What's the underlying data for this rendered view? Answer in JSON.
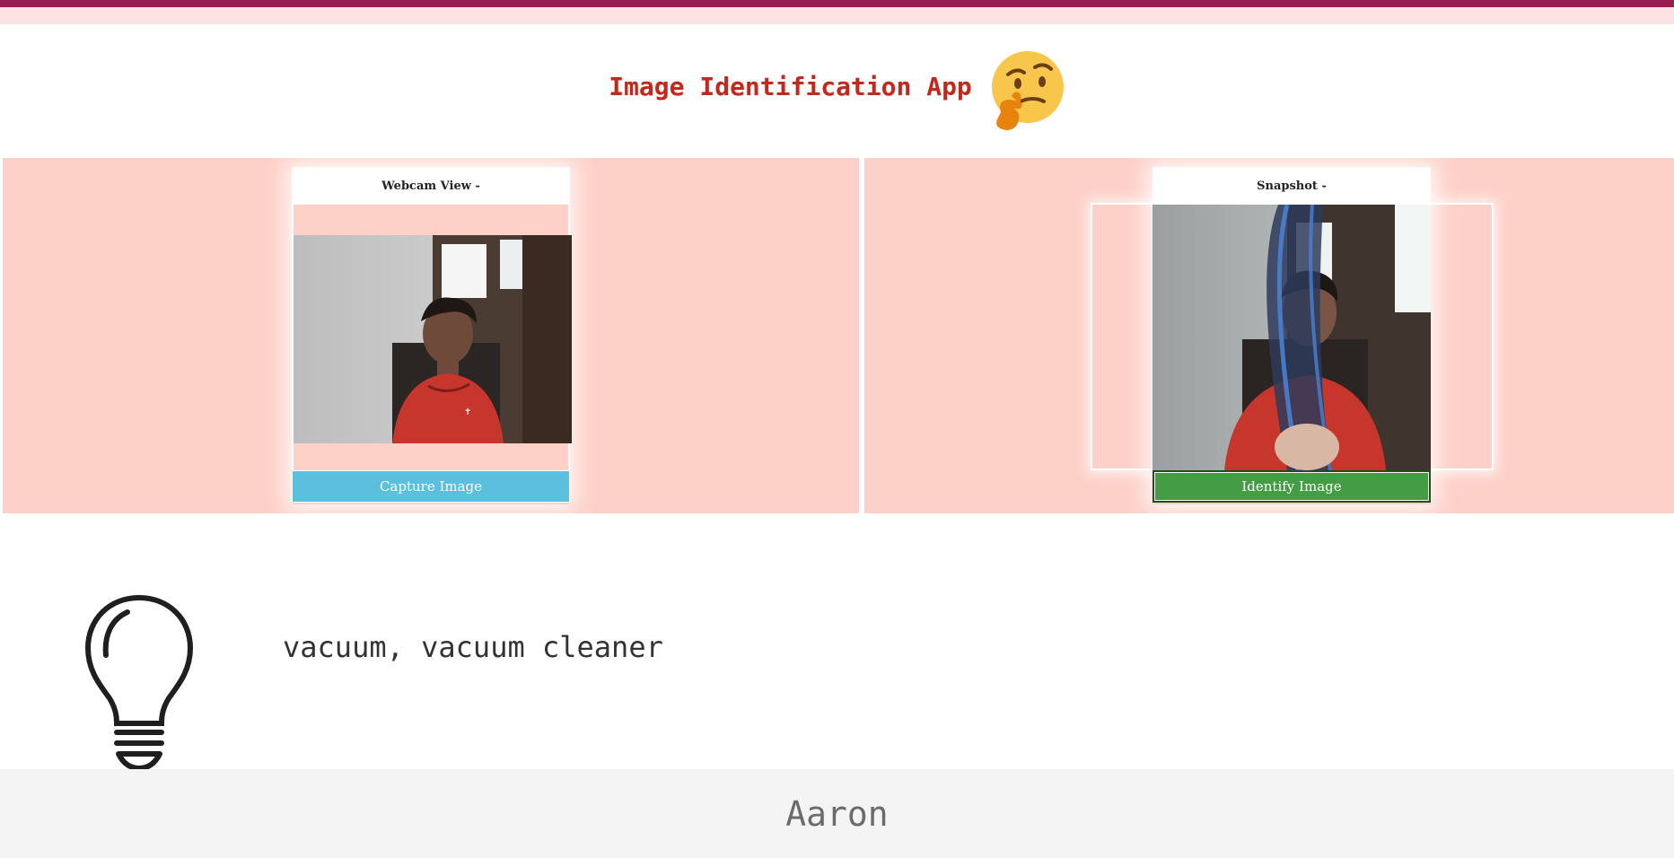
{
  "header": {
    "title": "Image Identification App",
    "emoji_icon": "thinking-face-icon"
  },
  "webcam": {
    "heading": "Webcam View -",
    "button_label": "Capture Image",
    "button_color": "#5bc0de"
  },
  "snapshot": {
    "heading": "Snapshot -",
    "button_label": "Identify Image",
    "button_color": "#449d44"
  },
  "result": {
    "icon": "lightbulb-icon",
    "prediction": "vacuum, vacuum cleaner"
  },
  "footer": {
    "name": "Aaron"
  },
  "colors": {
    "accent_bar": "#9c1a52",
    "panel_bg": "#fdd1c8",
    "title_color": "#c4271b"
  }
}
